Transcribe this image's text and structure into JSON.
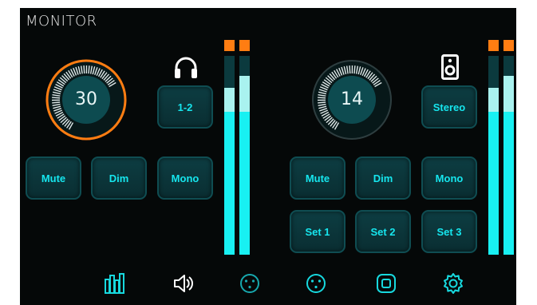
{
  "app": {
    "title": "MONITOR"
  },
  "left": {
    "knob_value": "30",
    "output_icon": "headphones-icon",
    "channel_button": "1-2",
    "buttons": {
      "mute": "Mute",
      "dim": "Dim",
      "mono": "Mono"
    },
    "meter_levels": {
      "left": {
        "level": 0.72,
        "highlight": 0.12
      },
      "right": {
        "level": 0.72,
        "highlight": 0.18
      }
    }
  },
  "right": {
    "knob_value": "14",
    "output_icon": "speaker-icon",
    "channel_button": "Stereo",
    "buttons": {
      "mute": "Mute",
      "dim": "Dim",
      "mono": "Mono",
      "set1": "Set 1",
      "set2": "Set 2",
      "set3": "Set 3"
    },
    "meter_levels": {
      "left": {
        "level": 0.72,
        "highlight": 0.12
      },
      "right": {
        "level": 0.72,
        "highlight": 0.18
      }
    }
  },
  "nav": {
    "items": [
      {
        "icon": "meters-icon",
        "active": true
      },
      {
        "icon": "volume-icon",
        "active": false
      },
      {
        "icon": "xlr-input-icon",
        "active": false
      },
      {
        "icon": "xlr-output-icon",
        "active": false
      },
      {
        "icon": "square-button-icon",
        "active": false
      },
      {
        "icon": "gear-icon",
        "active": false
      }
    ]
  },
  "colors": {
    "accent": "#16e6ee",
    "knob_active_ring": "#ff7d12",
    "peak": "#ff7d12",
    "background": "#050808"
  }
}
